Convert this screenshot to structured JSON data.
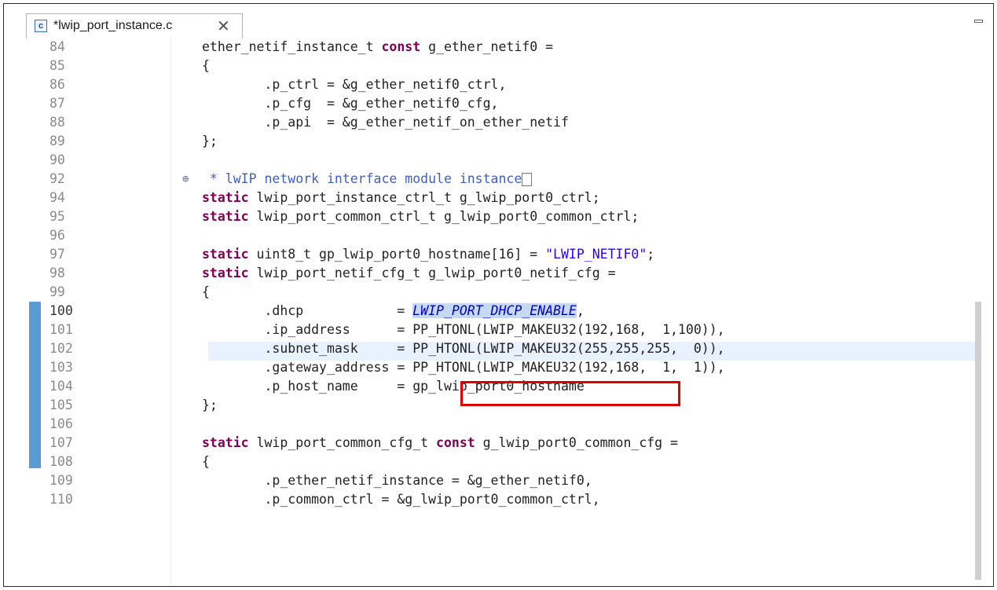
{
  "tab": {
    "label": "*lwip_port_instance.c",
    "close_glyph": "✕",
    "file_icon_glyph": "c"
  },
  "editor": {
    "lines": [
      {
        "n": "84",
        "t": "ether_netif_instance_t const g_ether_netif0 ="
      },
      {
        "n": "85",
        "t": "{"
      },
      {
        "n": "86",
        "t": "        .p_ctrl = &g_ether_netif0_ctrl,"
      },
      {
        "n": "87",
        "t": "        .p_cfg  = &g_ether_netif0_cfg,"
      },
      {
        "n": "88",
        "t": "        .p_api  = &g_ether_netif_on_ether_netif"
      },
      {
        "n": "89",
        "t": "};"
      },
      {
        "n": "90",
        "t": ""
      },
      {
        "n": "92",
        "t": " * lwIP network interface module instance"
      },
      {
        "n": "94",
        "t": "static lwip_port_instance_ctrl_t g_lwip_port0_ctrl;"
      },
      {
        "n": "95",
        "t": "static lwip_port_common_ctrl_t g_lwip_port0_common_ctrl;"
      },
      {
        "n": "96",
        "t": ""
      },
      {
        "n": "97",
        "t": "static uint8_t gp_lwip_port0_hostname[16] = \"LWIP_NETIF0\";"
      },
      {
        "n": "98",
        "t": "static lwip_port_netif_cfg_t g_lwip_port0_netif_cfg ="
      },
      {
        "n": "99",
        "t": "{"
      },
      {
        "n": "100",
        "t": "        .dhcp            = LWIP_PORT_DHCP_ENABLE,"
      },
      {
        "n": "101",
        "t": "        .ip_address      = PP_HTONL(LWIP_MAKEU32(192,168,  1,100)),"
      },
      {
        "n": "102",
        "t": "        .subnet_mask     = PP_HTONL(LWIP_MAKEU32(255,255,255,  0)),"
      },
      {
        "n": "103",
        "t": "        .gateway_address = PP_HTONL(LWIP_MAKEU32(192,168,  1,  1)),"
      },
      {
        "n": "104",
        "t": "        .p_host_name     = gp_lwip_port0_hostname"
      },
      {
        "n": "105",
        "t": "};"
      },
      {
        "n": "106",
        "t": ""
      },
      {
        "n": "107",
        "t": "static lwip_port_common_cfg_t const g_lwip_port0_common_cfg ="
      },
      {
        "n": "108",
        "t": "{"
      },
      {
        "n": "109",
        "t": "        .p_ether_netif_instance = &g_ether_netif0,"
      },
      {
        "n": "110",
        "t": "        .p_common_ctrl = &g_lwip_port0_common_ctrl,"
      }
    ],
    "current_line": "100",
    "selected_macro": "LWIP_PORT_DHCP_ENABLE",
    "fold_glyph": "⊕"
  },
  "colors": {
    "keyword": "#7f0055",
    "string": "#2a00ff",
    "comment": "#3f5fbf",
    "highlight_box": "#e00000",
    "change_bar": "#5b9bd5",
    "current_line_bg": "#e8f2fe"
  }
}
